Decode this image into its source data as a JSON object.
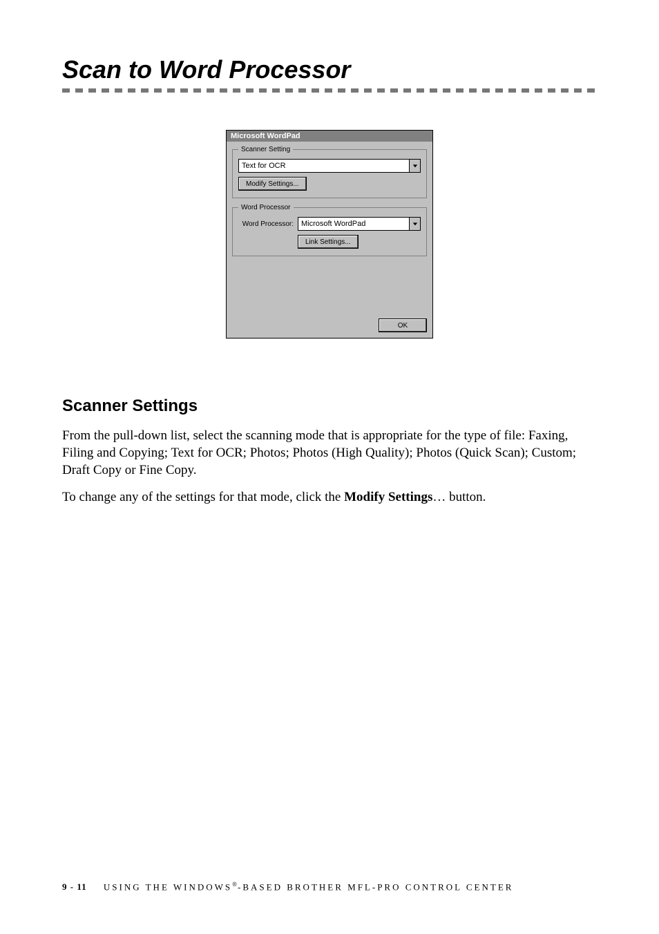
{
  "page": {
    "title": "Scan to Word Processor",
    "section_heading": "Scanner Settings",
    "para1": "From the pull-down list, select the scanning mode that is appropriate for the type of file:  Faxing, Filing and Copying; Text for OCR; Photos; Photos (High Quality); Photos (Quick Scan); Custom; Draft Copy or Fine Copy.",
    "para2_pre": "To change any of the settings for that mode, click the ",
    "para2_bold": "Modify Settings",
    "para2_post": "… button."
  },
  "dialog": {
    "title": "Microsoft WordPad",
    "group_scanner": "Scanner Setting",
    "scan_mode_value": "Text for OCR",
    "modify_settings_label": "Modify Settings...",
    "group_wp": "Word Processor",
    "wp_label": "Word Processor:",
    "wp_value": "Microsoft WordPad",
    "link_settings_label": "Link Settings...",
    "ok_label": "OK"
  },
  "footer": {
    "page_number": "9 - 11",
    "text_pre": "USING THE WINDOWS",
    "reg": "®",
    "text_post": "-BASED BROTHER MFL-PRO CONTROL CENTER"
  }
}
